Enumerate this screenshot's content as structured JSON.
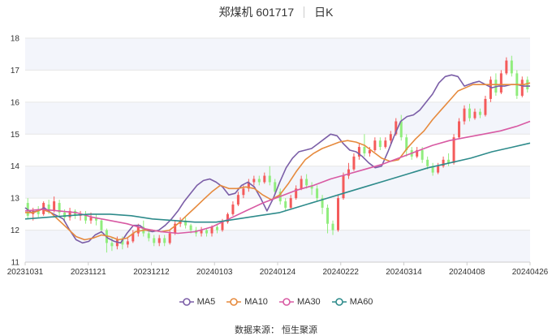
{
  "title": {
    "stock": "郑煤机 601717",
    "period": "日K"
  },
  "source": "数据来源：  恒生聚源",
  "colors": {
    "up": "#f45b5b",
    "down": "#90ed7d",
    "grid": "#e6e6e6",
    "band": "#f3f5fb"
  },
  "chart_data": {
    "type": "candlestick",
    "title": "郑煤机 601717",
    "ylim": [
      11,
      18
    ],
    "y_ticks": [
      "11",
      "12",
      "13",
      "14",
      "15",
      "16",
      "17",
      "18"
    ],
    "x_ticks": [
      "20231031",
      "20231121",
      "20231212",
      "20240103",
      "20240124",
      "20240222",
      "20240314",
      "20240408",
      "20240426"
    ],
    "legend": [
      {
        "name": "MA5",
        "color": "#7b5ea7"
      },
      {
        "name": "MA10",
        "color": "#e68a3d"
      },
      {
        "name": "MA30",
        "color": "#d85aa3"
      },
      {
        "name": "MA60",
        "color": "#2e8b8b"
      }
    ],
    "ma_series": [
      {
        "name": "MA5",
        "x": [
          0,
          3,
          6,
          9,
          12,
          15,
          18,
          21,
          24,
          27,
          30,
          33,
          36,
          39,
          42,
          45,
          48,
          51,
          54,
          57,
          60,
          63,
          66,
          69,
          72,
          75,
          78,
          81,
          84,
          87,
          90,
          93,
          96,
          99,
          102,
          105,
          108,
          111,
          114,
          117,
          120,
          123,
          126,
          129,
          132,
          135,
          138,
          141,
          144,
          147,
          150,
          153,
          156,
          159,
          162,
          165,
          168,
          171,
          174,
          177,
          180,
          183,
          186,
          189,
          192,
          195,
          198,
          201,
          204,
          207,
          211,
          214,
          217,
          220,
          223,
          226,
          229,
          232,
          235,
          238
        ],
        "y": [
          12.7,
          12.55,
          12.6,
          12.7,
          12.55,
          12.45,
          12.35,
          12.0,
          11.7,
          11.6,
          11.65,
          11.85,
          11.95,
          11.75,
          11.65,
          11.6,
          11.9,
          12.15,
          12.15,
          12.0,
          11.95,
          12.0,
          12.15,
          12.35,
          12.6,
          12.9,
          13.15,
          13.4,
          13.55,
          13.6,
          13.5,
          13.35,
          13.1,
          13.15,
          13.4,
          13.5,
          13.35,
          13.0,
          12.6,
          13.0,
          13.5,
          13.95,
          14.25,
          14.45,
          14.5,
          14.55,
          14.7,
          14.85,
          15.0,
          14.95,
          14.7,
          14.5,
          14.45,
          14.3,
          14.1,
          13.95,
          14.0,
          14.45,
          14.95,
          15.4,
          15.55,
          15.6,
          15.75,
          16.0,
          16.25,
          16.6,
          16.8,
          16.85,
          16.8,
          16.5,
          16.6,
          16.65,
          16.55,
          16.45,
          16.5,
          16.5,
          16.55,
          16.55,
          16.5,
          16.5
        ]
      },
      {
        "name": "MA10",
        "x": [
          0,
          4,
          8,
          12,
          16,
          20,
          24,
          28,
          32,
          36,
          40,
          44,
          48,
          52,
          56,
          60,
          64,
          68,
          72,
          76,
          80,
          84,
          88,
          92,
          96,
          100,
          104,
          108,
          112,
          116,
          120,
          124,
          128,
          132,
          136,
          140,
          144,
          148,
          152,
          156,
          160,
          164,
          168,
          172,
          176,
          180,
          184,
          188,
          192,
          196,
          200,
          204,
          211,
          214,
          217,
          220,
          223,
          226,
          229,
          232,
          235,
          238
        ],
        "y": [
          12.55,
          12.55,
          12.65,
          12.55,
          12.3,
          12.05,
          11.8,
          11.7,
          11.75,
          11.85,
          11.8,
          11.7,
          11.75,
          11.95,
          12.0,
          12.0,
          11.95,
          12.0,
          12.2,
          12.45,
          12.7,
          12.95,
          13.2,
          13.4,
          13.3,
          13.3,
          13.35,
          13.3,
          13.1,
          12.95,
          13.1,
          13.45,
          13.85,
          14.2,
          14.4,
          14.55,
          14.65,
          14.75,
          14.8,
          14.75,
          14.65,
          14.45,
          14.25,
          14.15,
          14.2,
          14.55,
          14.85,
          15.1,
          15.45,
          15.75,
          16.05,
          16.35,
          16.55,
          16.55,
          16.55,
          16.55,
          16.55,
          16.55,
          16.55,
          16.55,
          16.55,
          16.6
        ]
      },
      {
        "name": "MA30",
        "x": [
          0,
          8,
          16,
          24,
          32,
          40,
          48,
          56,
          64,
          72,
          80,
          88,
          96,
          104,
          112,
          120,
          128,
          136,
          144,
          152,
          160,
          168,
          176,
          184,
          192,
          200,
          208,
          216,
          224,
          232,
          238
        ],
        "y": [
          12.6,
          12.65,
          12.6,
          12.55,
          12.4,
          12.3,
          12.2,
          12.05,
          11.95,
          11.9,
          11.95,
          12.1,
          12.35,
          12.6,
          12.85,
          13.05,
          13.25,
          13.4,
          13.6,
          13.75,
          13.9,
          14.05,
          14.25,
          14.45,
          14.65,
          14.8,
          14.9,
          15.0,
          15.1,
          15.25,
          15.4
        ]
      },
      {
        "name": "MA60",
        "x": [
          0,
          10,
          20,
          30,
          40,
          50,
          60,
          70,
          80,
          90,
          100,
          110,
          120,
          130,
          140,
          150,
          160,
          170,
          180,
          190,
          200,
          210,
          220,
          230,
          238
        ],
        "y": [
          12.35,
          12.4,
          12.45,
          12.5,
          12.5,
          12.45,
          12.35,
          12.3,
          12.25,
          12.25,
          12.35,
          12.45,
          12.55,
          12.75,
          12.95,
          13.15,
          13.35,
          13.55,
          13.75,
          13.95,
          14.1,
          14.25,
          14.45,
          14.6,
          14.72
        ]
      }
    ],
    "candles": [
      {
        "o": 12.85,
        "c": 12.45,
        "h": 13.0,
        "l": 12.35
      },
      {
        "o": 12.5,
        "c": 12.6,
        "h": 12.7,
        "l": 12.3
      },
      {
        "o": 12.6,
        "c": 12.5,
        "h": 12.75,
        "l": 12.4
      },
      {
        "o": 12.5,
        "c": 12.85,
        "h": 12.9,
        "l": 12.45
      },
      {
        "o": 12.8,
        "c": 12.6,
        "h": 12.95,
        "l": 12.5
      },
      {
        "o": 12.6,
        "c": 12.9,
        "h": 13.05,
        "l": 12.55
      },
      {
        "o": 12.85,
        "c": 12.55,
        "h": 12.95,
        "l": 12.45
      },
      {
        "o": 12.55,
        "c": 12.4,
        "h": 12.65,
        "l": 12.3
      },
      {
        "o": 12.4,
        "c": 12.6,
        "h": 12.7,
        "l": 12.3
      },
      {
        "o": 12.6,
        "c": 12.45,
        "h": 12.65,
        "l": 12.35
      },
      {
        "o": 12.45,
        "c": 12.5,
        "h": 12.6,
        "l": 12.3
      },
      {
        "o": 12.5,
        "c": 12.3,
        "h": 12.6,
        "l": 12.2
      },
      {
        "o": 12.3,
        "c": 12.4,
        "h": 12.55,
        "l": 12.2
      },
      {
        "o": 12.4,
        "c": 12.3,
        "h": 12.5,
        "l": 12.15
      },
      {
        "o": 12.3,
        "c": 12.0,
        "h": 12.35,
        "l": 11.9
      },
      {
        "o": 12.0,
        "c": 11.6,
        "h": 12.05,
        "l": 11.3
      },
      {
        "o": 11.6,
        "c": 11.5,
        "h": 11.75,
        "l": 11.35
      },
      {
        "o": 11.5,
        "c": 11.7,
        "h": 11.8,
        "l": 11.4
      },
      {
        "o": 11.7,
        "c": 11.55,
        "h": 11.8,
        "l": 11.4
      },
      {
        "o": 11.55,
        "c": 11.65,
        "h": 11.75,
        "l": 11.45
      },
      {
        "o": 11.65,
        "c": 11.9,
        "h": 12.0,
        "l": 11.6
      },
      {
        "o": 11.9,
        "c": 12.1,
        "h": 12.2,
        "l": 11.8
      },
      {
        "o": 12.1,
        "c": 11.9,
        "h": 12.3,
        "l": 11.8
      },
      {
        "o": 11.9,
        "c": 11.75,
        "h": 12.0,
        "l": 11.65
      },
      {
        "o": 11.75,
        "c": 11.6,
        "h": 11.85,
        "l": 11.5
      },
      {
        "o": 11.6,
        "c": 11.75,
        "h": 11.85,
        "l": 11.5
      },
      {
        "o": 11.75,
        "c": 11.6,
        "h": 11.85,
        "l": 11.5
      },
      {
        "o": 11.6,
        "c": 11.9,
        "h": 12.0,
        "l": 11.55
      },
      {
        "o": 11.9,
        "c": 12.2,
        "h": 12.3,
        "l": 11.85
      },
      {
        "o": 12.2,
        "c": 12.3,
        "h": 12.4,
        "l": 12.1
      },
      {
        "o": 12.3,
        "c": 12.15,
        "h": 12.4,
        "l": 12.05
      },
      {
        "o": 12.15,
        "c": 12.0,
        "h": 12.2,
        "l": 11.9
      },
      {
        "o": 12.0,
        "c": 11.9,
        "h": 12.1,
        "l": 11.8
      },
      {
        "o": 11.9,
        "c": 12.0,
        "h": 12.1,
        "l": 11.8
      },
      {
        "o": 12.0,
        "c": 11.9,
        "h": 12.05,
        "l": 11.8
      },
      {
        "o": 11.9,
        "c": 12.1,
        "h": 12.15,
        "l": 11.8
      },
      {
        "o": 12.1,
        "c": 12.0,
        "h": 12.2,
        "l": 11.9
      },
      {
        "o": 12.0,
        "c": 12.25,
        "h": 12.35,
        "l": 11.95
      },
      {
        "o": 12.25,
        "c": 12.5,
        "h": 12.55,
        "l": 12.2
      },
      {
        "o": 12.5,
        "c": 12.8,
        "h": 12.9,
        "l": 12.45
      },
      {
        "o": 12.8,
        "c": 13.1,
        "h": 13.2,
        "l": 12.75
      },
      {
        "o": 13.1,
        "c": 13.3,
        "h": 13.4,
        "l": 13.0
      },
      {
        "o": 13.3,
        "c": 13.5,
        "h": 13.6,
        "l": 13.2
      },
      {
        "o": 13.5,
        "c": 13.6,
        "h": 13.7,
        "l": 13.4
      },
      {
        "o": 13.6,
        "c": 13.5,
        "h": 13.7,
        "l": 13.4
      },
      {
        "o": 13.5,
        "c": 13.7,
        "h": 13.8,
        "l": 13.45
      },
      {
        "o": 13.7,
        "c": 13.5,
        "h": 14.0,
        "l": 13.4
      },
      {
        "o": 13.5,
        "c": 13.2,
        "h": 13.6,
        "l": 13.1
      },
      {
        "o": 13.2,
        "c": 12.9,
        "h": 13.3,
        "l": 12.8
      },
      {
        "o": 12.9,
        "c": 12.7,
        "h": 13.0,
        "l": 12.6
      },
      {
        "o": 12.7,
        "c": 13.0,
        "h": 13.1,
        "l": 12.65
      },
      {
        "o": 13.0,
        "c": 13.3,
        "h": 13.4,
        "l": 12.95
      },
      {
        "o": 13.3,
        "c": 13.6,
        "h": 13.7,
        "l": 13.25
      },
      {
        "o": 13.6,
        "c": 13.4,
        "h": 13.75,
        "l": 13.3
      },
      {
        "o": 13.4,
        "c": 13.3,
        "h": 13.5,
        "l": 13.1
      },
      {
        "o": 13.3,
        "c": 13.0,
        "h": 13.4,
        "l": 12.9
      },
      {
        "o": 13.0,
        "c": 12.7,
        "h": 13.1,
        "l": 12.5
      },
      {
        "o": 12.7,
        "c": 12.2,
        "h": 12.8,
        "l": 11.9
      },
      {
        "o": 12.2,
        "c": 12.0,
        "h": 12.3,
        "l": 11.85
      },
      {
        "o": 12.0,
        "c": 13.0,
        "h": 13.1,
        "l": 11.95
      },
      {
        "o": 13.0,
        "c": 13.7,
        "h": 13.8,
        "l": 12.95
      },
      {
        "o": 13.7,
        "c": 13.9,
        "h": 14.1,
        "l": 13.6
      },
      {
        "o": 13.9,
        "c": 14.3,
        "h": 14.4,
        "l": 13.85
      },
      {
        "o": 14.3,
        "c": 14.6,
        "h": 14.7,
        "l": 14.2
      },
      {
        "o": 14.6,
        "c": 14.4,
        "h": 15.0,
        "l": 14.3
      },
      {
        "o": 14.4,
        "c": 14.5,
        "h": 14.6,
        "l": 14.3
      },
      {
        "o": 14.5,
        "c": 14.8,
        "h": 14.9,
        "l": 14.45
      },
      {
        "o": 14.8,
        "c": 14.6,
        "h": 14.9,
        "l": 14.5
      },
      {
        "o": 14.6,
        "c": 14.8,
        "h": 14.9,
        "l": 14.55
      },
      {
        "o": 14.8,
        "c": 15.0,
        "h": 15.1,
        "l": 14.7
      },
      {
        "o": 15.0,
        "c": 15.4,
        "h": 15.5,
        "l": 14.95
      },
      {
        "o": 15.4,
        "c": 14.9,
        "h": 15.6,
        "l": 14.8
      },
      {
        "o": 14.9,
        "c": 14.5,
        "h": 15.0,
        "l": 14.3
      },
      {
        "o": 14.5,
        "c": 14.3,
        "h": 14.6,
        "l": 14.2
      },
      {
        "o": 14.3,
        "c": 14.5,
        "h": 14.6,
        "l": 14.25
      },
      {
        "o": 14.5,
        "c": 14.2,
        "h": 14.6,
        "l": 14.1
      },
      {
        "o": 14.2,
        "c": 14.0,
        "h": 14.3,
        "l": 13.9
      },
      {
        "o": 14.0,
        "c": 13.8,
        "h": 14.1,
        "l": 13.7
      },
      {
        "o": 13.8,
        "c": 14.0,
        "h": 14.1,
        "l": 13.75
      },
      {
        "o": 14.0,
        "c": 14.2,
        "h": 14.3,
        "l": 13.95
      },
      {
        "o": 14.2,
        "c": 14.1,
        "h": 14.4,
        "l": 14.0
      },
      {
        "o": 14.1,
        "c": 14.9,
        "h": 15.0,
        "l": 14.05
      },
      {
        "o": 14.9,
        "c": 15.4,
        "h": 15.5,
        "l": 14.85
      },
      {
        "o": 15.4,
        "c": 15.8,
        "h": 15.9,
        "l": 15.3
      },
      {
        "o": 15.8,
        "c": 15.5,
        "h": 15.95,
        "l": 15.4
      },
      {
        "o": 15.5,
        "c": 15.7,
        "h": 15.8,
        "l": 15.45
      },
      {
        "o": 15.7,
        "c": 15.6,
        "h": 15.8,
        "l": 15.5
      },
      {
        "o": 15.6,
        "c": 16.1,
        "h": 16.2,
        "l": 15.55
      },
      {
        "o": 16.1,
        "c": 16.7,
        "h": 16.8,
        "l": 16.0
      },
      {
        "o": 16.7,
        "c": 16.3,
        "h": 16.9,
        "l": 16.2
      },
      {
        "o": 16.3,
        "c": 16.9,
        "h": 17.0,
        "l": 16.25
      },
      {
        "o": 16.9,
        "c": 17.3,
        "h": 17.4,
        "l": 16.85
      },
      {
        "o": 17.3,
        "c": 16.9,
        "h": 17.45,
        "l": 16.8
      },
      {
        "o": 16.9,
        "c": 16.2,
        "h": 17.0,
        "l": 16.1
      },
      {
        "o": 16.2,
        "c": 16.7,
        "h": 16.8,
        "l": 16.15
      },
      {
        "o": 16.7,
        "c": 16.4,
        "h": 16.8,
        "l": 16.3
      }
    ]
  }
}
